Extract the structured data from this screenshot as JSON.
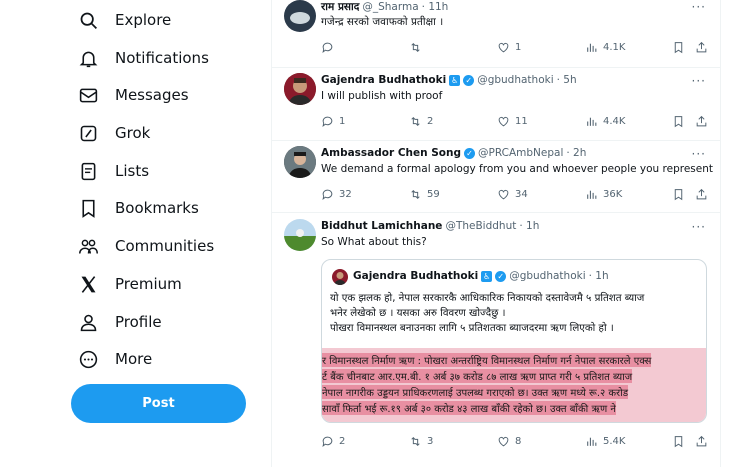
{
  "sidebar": {
    "items": [
      {
        "label": "Explore",
        "icon": "search-icon"
      },
      {
        "label": "Notifications",
        "icon": "bell-icon"
      },
      {
        "label": "Messages",
        "icon": "envelope-icon"
      },
      {
        "label": "Grok",
        "icon": "grok-icon"
      },
      {
        "label": "Lists",
        "icon": "list-icon"
      },
      {
        "label": "Bookmarks",
        "icon": "bookmark-icon"
      },
      {
        "label": "Communities",
        "icon": "communities-icon"
      },
      {
        "label": "Premium",
        "icon": "x-logo-icon"
      },
      {
        "label": "Profile",
        "icon": "person-icon"
      },
      {
        "label": "More",
        "icon": "more-circle-icon"
      }
    ],
    "post_label": "Post"
  },
  "tweets": [
    {
      "name": "राम प्रसाद",
      "handle": "@_Sharma",
      "time": "· 11h",
      "text": "गजेन्द्र सरको जवाफको प्रतीक्षा ।",
      "stats": {
        "replies": "",
        "reposts": "",
        "likes": "1",
        "views": "4.1K"
      }
    },
    {
      "name": "Gajendra Budhathoki",
      "handle": "@gbudhathoki",
      "time": "· 5h",
      "text": "I will publish with proof",
      "stats": {
        "replies": "1",
        "reposts": "2",
        "likes": "11",
        "views": "4.4K"
      }
    },
    {
      "name": "Ambassador Chen Song",
      "handle": "@PRCAmbNepal",
      "time": "· 2h",
      "text": "We demand a formal apology from you and whoever people you represent",
      "stats": {
        "replies": "32",
        "reposts": "59",
        "likes": "34",
        "views": "36K"
      }
    },
    {
      "name": "Biddhut Lamichhane",
      "handle": "@TheBiddhut",
      "time": "· 1h",
      "text": "So What about this?",
      "stats": {
        "replies": "2",
        "reposts": "3",
        "likes": "8",
        "views": "5.4K"
      },
      "quote": {
        "name": "Gajendra Budhathoki",
        "handle": "@gbudhathoki",
        "time": "· 1h",
        "lines": [
          "यो एक झलक हो, नेपाल सरकारकै आधिकारिक निकायको दस्तावेजमै ५ प्रतिशत ब्याज",
          "भनेर लेखेको छ । यसका अरु विवरण खोज्दैछु ।",
          "पोखरा विमानस्थल बनाउनका लागि ५ प्रतिशतका ब्याजदरमा ऋण लिएको हो ।"
        ],
        "image_lines": [
          "र विमानस्थल निर्माण ऋण :  पोखरा अन्तर्राष्ट्रिय विमानस्थल निर्माण गर्न नेपाल सरकारले एक्स",
          "र्ट बैंक चीनबाट आर.एम.बी. १ अर्ब ३७ करोड ८७ लाख ऋण प्राप्त गरी ५ प्रतिशत ब्याज",
          "नेपाल नागरीक उड्डयन प्राधिकरणलाई उपलब्ध गराएको छ।  उक्त ऋण मध्ये रू.२ करोड",
          "सावाँ फिर्ता भई रू.१९ अर्ब ३० करोड ४३ लाख बाँकी रहेको छ।  उक्त बाँकी ऋण ने"
        ]
      }
    }
  ],
  "colors": {
    "accent": "#1d9bf0",
    "muted": "#536471",
    "highlight": "#e88fa2"
  }
}
